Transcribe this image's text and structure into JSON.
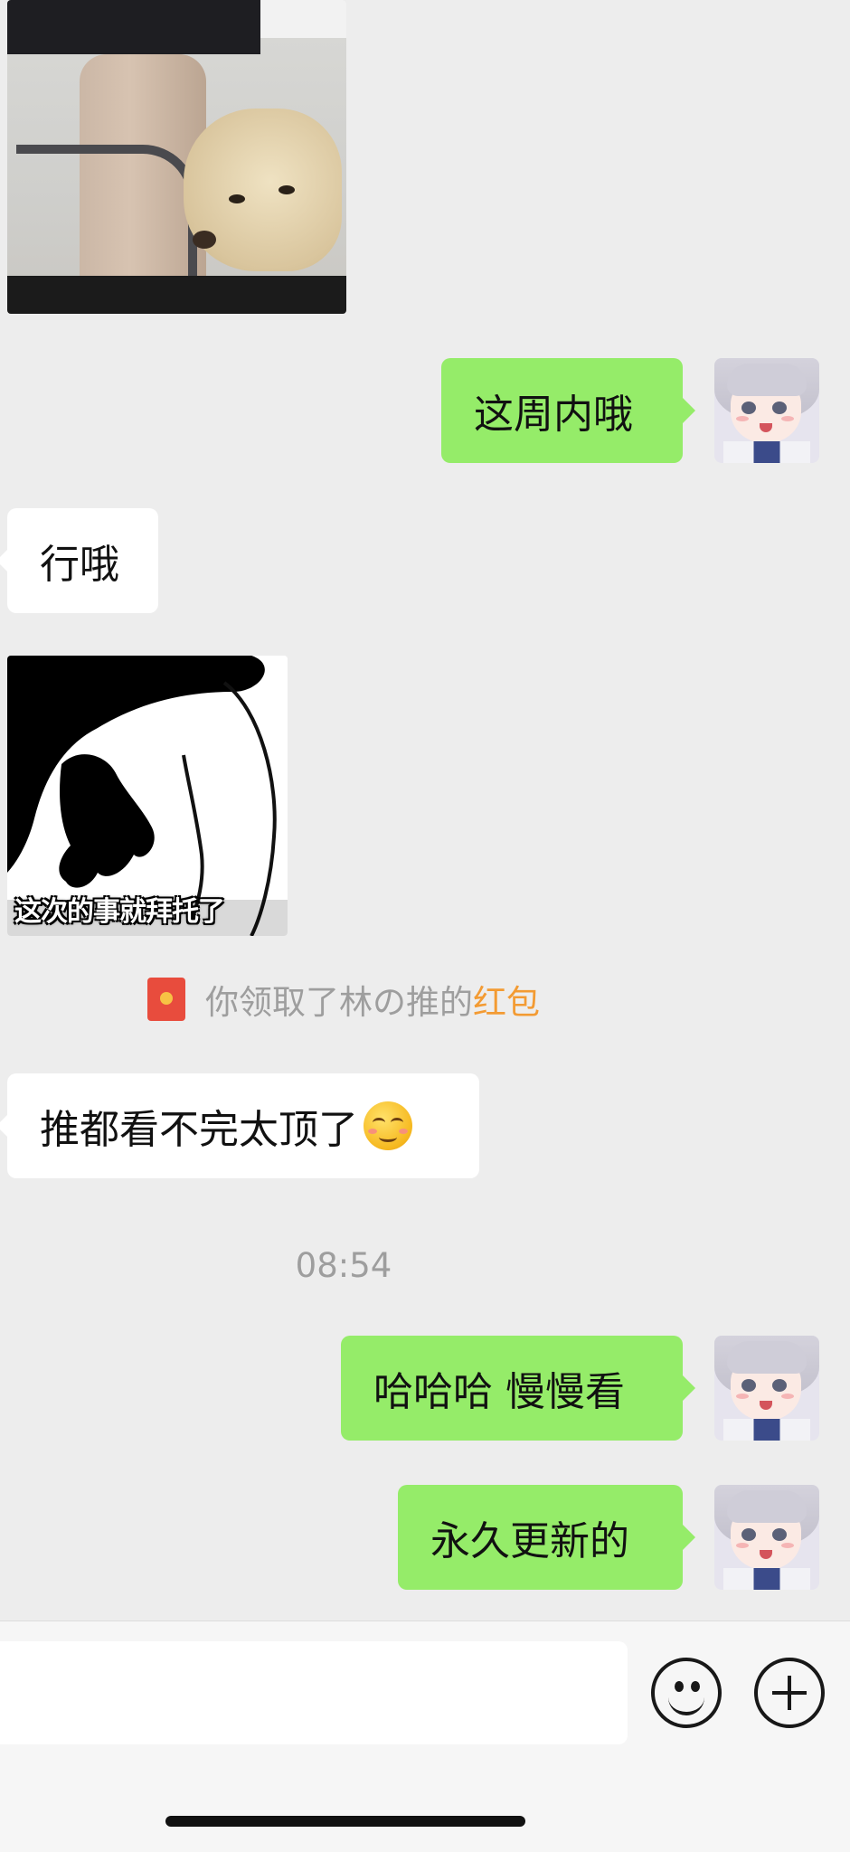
{
  "messages": {
    "dog_image": {
      "alt": "dog under chair image"
    },
    "msg1": {
      "text": "这周内哦",
      "sender": "self"
    },
    "msg2": {
      "text": "行哦",
      "sender": "other"
    },
    "sticker": {
      "caption": "这次的事就拜托了"
    },
    "system_notice": {
      "prefix": "你领取了林の推的",
      "highlight": "红包"
    },
    "msg3": {
      "text": "推都看不完太顶了",
      "emoji": "smirk-face-emoji",
      "sender": "other"
    },
    "timestamp": "08:54",
    "msg4": {
      "text": "哈哈哈 慢慢看",
      "sender": "self"
    },
    "msg5": {
      "text": "永久更新的",
      "sender": "self"
    }
  },
  "input_bar": {
    "value": "",
    "icons": [
      "smile-icon",
      "plus-icon"
    ]
  },
  "colors": {
    "background": "#ededed",
    "self_bubble": "#95ec69",
    "other_bubble": "#ffffff",
    "highlight": "#f39b33",
    "system_text": "#9e9e9e"
  }
}
